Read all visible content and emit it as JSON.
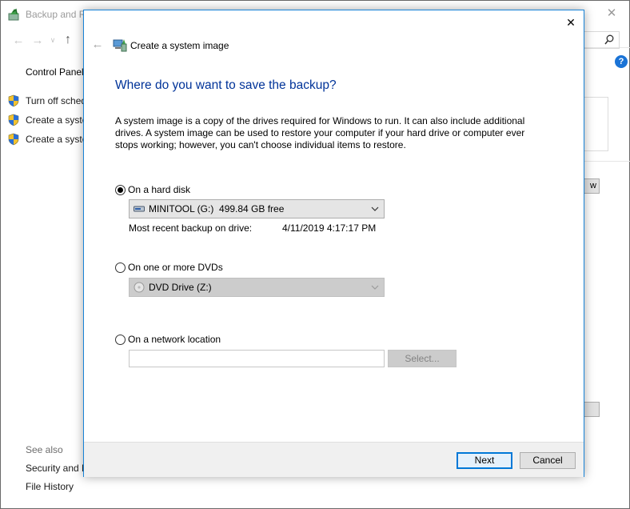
{
  "background_window": {
    "title": "Backup and R",
    "sidebar_title": "Control Panel",
    "links": [
      "Turn off sched",
      "Create a syste",
      "Create a syste"
    ],
    "see_also_label": "See also",
    "see_also_links": [
      "Security and M",
      "File History"
    ],
    "right_button_fragment": "w"
  },
  "dialog": {
    "title": "Create a system image",
    "heading": "Where do you want to save the backup?",
    "description": "A system image is a copy of the drives required for Windows to run. It can also include additional drives. A system image can be used to restore your computer if your hard drive or computer ever stops working; however, you can't choose individual items to restore.",
    "options": {
      "hard_disk": {
        "label": "On a hard disk",
        "checked": true,
        "drive_label": "MINITOOL (G:)",
        "drive_free": "499.84 GB free",
        "recent_backup_label": "Most recent backup on drive:",
        "recent_backup_date": "4/11/2019 4:17:17 PM"
      },
      "dvd": {
        "label": "On one or more DVDs",
        "checked": false,
        "drive_label": "DVD Drive (Z:)"
      },
      "network": {
        "label": "On a network location",
        "checked": false,
        "path_value": "",
        "select_label": "Select..."
      }
    },
    "buttons": {
      "next": "Next",
      "cancel": "Cancel"
    }
  },
  "colors": {
    "heading": "#003399",
    "accent": "#0078d7",
    "dialog_border": "#1883d7"
  }
}
